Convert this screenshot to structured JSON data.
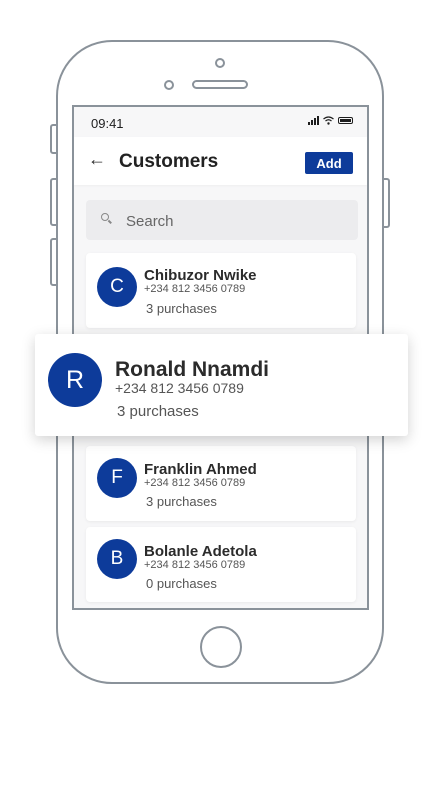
{
  "status_bar": {
    "time": "09:41"
  },
  "header": {
    "title": "Customers",
    "back_icon": "arrow-left-icon",
    "add_label": "Add"
  },
  "search": {
    "placeholder": "Search"
  },
  "colors": {
    "accent": "#0d3b9a"
  },
  "customers": [
    {
      "initial": "C",
      "name": "Chibuzor Nwike",
      "phone": "+234 812 3456 0789",
      "purchases": "3 purchases"
    },
    {
      "initial": "R",
      "name": "Ronald Nnamdi",
      "phone": "+234 812 3456 0789",
      "purchases": "3 purchases"
    },
    {
      "initial": "F",
      "name": "Franklin Ahmed",
      "phone": "+234 812 3456 0789",
      "purchases": "3 purchases"
    },
    {
      "initial": "B",
      "name": "Bolanle Adetola",
      "phone": "+234 812 3456 0789",
      "purchases": "0 purchases"
    }
  ]
}
